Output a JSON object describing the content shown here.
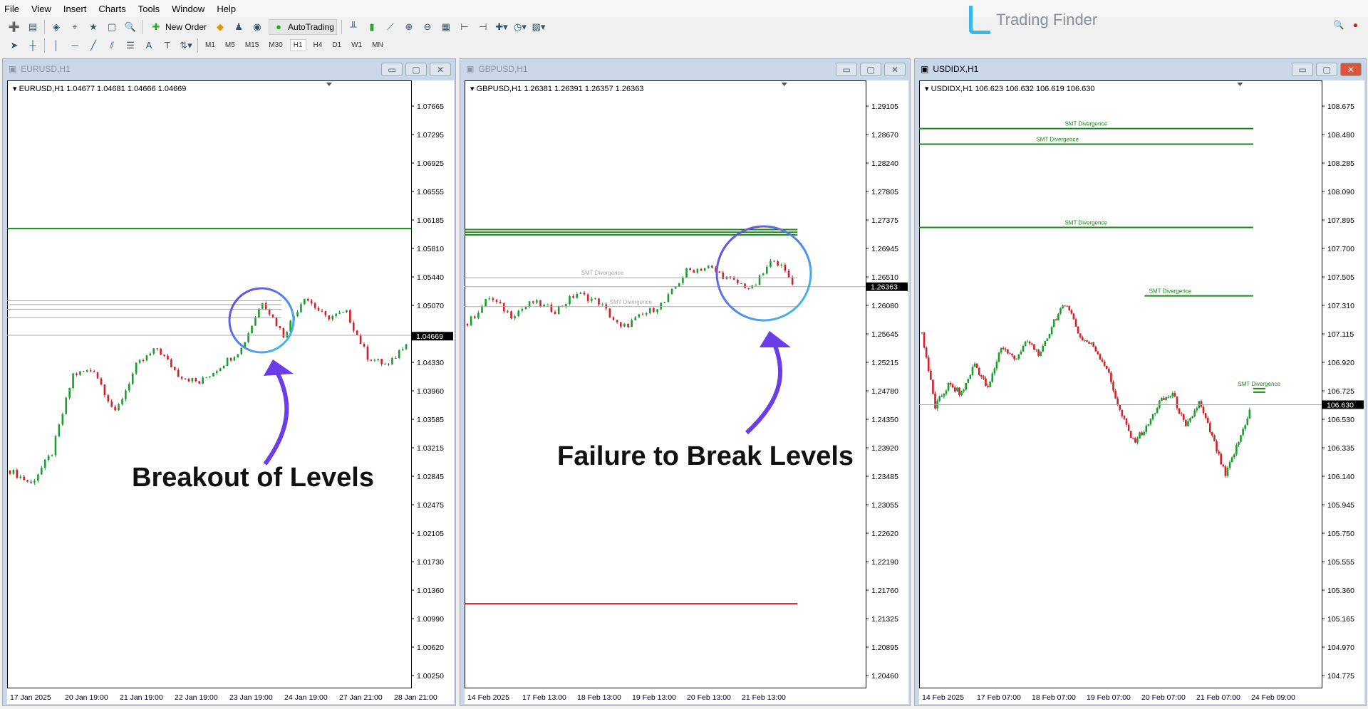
{
  "menu": [
    "File",
    "View",
    "Insert",
    "Charts",
    "Tools",
    "Window",
    "Help"
  ],
  "toolbar": {
    "new_order": "New Order",
    "autotrading": "AutoTrading",
    "timeframes": [
      "M1",
      "M5",
      "M15",
      "M30",
      "H1",
      "H4",
      "D1",
      "W1",
      "MN"
    ],
    "active_timeframe": "H1"
  },
  "logo": {
    "text": "Trading Finder",
    "color": "#35b8e8"
  },
  "colors": {
    "bull": "#1a9e2e",
    "bear": "#d0202a",
    "level_green": "#1a8a1a",
    "level_red": "#d0202a",
    "grid_line": "#aaaaaa"
  },
  "windows": [
    {
      "title": "EURUSD,H1",
      "ohlc": "EURUSD,H1  1.04677 1.04681 1.04666 1.04669",
      "current_price": "1.04669",
      "yticks": [
        "1.07665",
        "1.07295",
        "1.06925",
        "1.06555",
        "1.06185",
        "1.05810",
        "1.05440",
        "1.05070",
        "1.04700",
        "1.04330",
        "1.03960",
        "1.03585",
        "1.03215",
        "1.02845",
        "1.02475",
        "1.02105",
        "1.01730",
        "1.01360",
        "1.00990",
        "1.00620",
        "1.00250"
      ],
      "xticks": [
        "17 Jan 2025",
        "20 Jan 19:00",
        "21 Jan 19:00",
        "22 Jan 19:00",
        "23 Jan 19:00",
        "24 Jan 19:00",
        "27 Jan 21:00",
        "28 Jan 21:00"
      ],
      "closes": [
        1.0292,
        1.0275,
        1.0315,
        1.0417,
        1.0423,
        1.0366,
        1.0428,
        1.0451,
        1.0417,
        1.0406,
        1.0428,
        1.0451,
        1.0513,
        1.0468,
        1.0519,
        1.0491,
        1.0497,
        1.044,
        1.0428,
        1.04669
      ],
      "levels": [
        {
          "price": 1.0607,
          "color": "green",
          "full": true
        },
        {
          "price": 1.0513,
          "color": "grey"
        },
        {
          "price": 1.0508,
          "color": "grey"
        },
        {
          "price": 1.0502,
          "color": "grey"
        },
        {
          "price": 1.0491,
          "color": "grey"
        },
        {
          "price": 1.0468,
          "color": "grey",
          "full": true
        }
      ],
      "annotation": "Breakout of Levels"
    },
    {
      "title": "GBPUSD,H1",
      "ohlc": "GBPUSD,H1  1.26381 1.26391 1.26357 1.26363",
      "current_price": "1.26363",
      "yticks": [
        "1.29105",
        "1.28670",
        "1.28240",
        "1.27805",
        "1.27375",
        "1.26945",
        "1.26510",
        "1.26080",
        "1.25645",
        "1.25215",
        "1.24780",
        "1.24350",
        "1.23920",
        "1.23485",
        "1.23055",
        "1.22620",
        "1.22190",
        "1.21760",
        "1.21325",
        "1.20895",
        "1.20460"
      ],
      "xticks": [
        "14 Feb 2025",
        "17 Feb 13:00",
        "18 Feb 13:00",
        "19 Feb 13:00",
        "20 Feb 13:00",
        "21 Feb 13:00"
      ],
      "closes": [
        1.258,
        1.262,
        1.2593,
        1.2613,
        1.26,
        1.2626,
        1.2613,
        1.2573,
        1.2593,
        1.2613,
        1.266,
        1.2666,
        1.2646,
        1.2633,
        1.268,
        1.26363
      ],
      "levels": [
        {
          "price": 1.2723,
          "color": "green"
        },
        {
          "price": 1.2719,
          "color": "green"
        },
        {
          "price": 1.2715,
          "color": "green"
        },
        {
          "price": 1.265,
          "color": "grey",
          "label": "SMT Divergence"
        },
        {
          "price": 1.2606,
          "color": "grey",
          "label": "SMT Divergence"
        },
        {
          "price": 1.2155,
          "color": "red"
        },
        {
          "price": 1.26363,
          "color": "grey",
          "full": true
        }
      ],
      "annotation": "Failure to Break Levels"
    },
    {
      "title": "USDIDX,H1",
      "ohlc": "USDIDX,H1  106.623 106.632 106.619 106.630",
      "current_price": "106.630",
      "yticks": [
        "108.675",
        "108.480",
        "108.285",
        "108.090",
        "107.895",
        "107.700",
        "107.505",
        "107.310",
        "107.115",
        "106.920",
        "106.725",
        "106.530",
        "106.335",
        "106.140",
        "105.945",
        "105.750",
        "105.555",
        "105.360",
        "105.165",
        "104.970",
        "104.775"
      ],
      "xticks": [
        "14 Feb 2025",
        "17 Feb 07:00",
        "18 Feb 07:00",
        "19 Feb 07:00",
        "20 Feb 07:00",
        "21 Feb 07:00",
        "24 Feb 09:00"
      ],
      "closes": [
        107.12,
        106.615,
        106.764,
        106.704,
        106.912,
        106.734,
        107.031,
        106.942,
        107.06,
        106.971,
        107.209,
        107.328,
        107.09,
        107.031,
        106.882,
        106.586,
        106.378,
        106.467,
        106.645,
        106.704,
        106.467,
        106.645,
        106.407,
        106.14,
        106.378,
        106.63
      ],
      "levels": [
        {
          "price": 108.521,
          "color": "green",
          "label": "SMT Divergence"
        },
        {
          "price": 108.414,
          "color": "green",
          "label": "SMT Divergence"
        },
        {
          "price": 107.844,
          "color": "green",
          "label": "SMT Divergence"
        },
        {
          "price": 107.375,
          "color": "green",
          "label": "SMT Divergence",
          "from": 0.56
        },
        {
          "price": 106.74,
          "color": "green",
          "label": "SMT Divergence",
          "from": 0.86
        },
        {
          "price": 106.716,
          "color": "green",
          "from": 0.86
        },
        {
          "price": 106.63,
          "color": "grey",
          "full": true
        }
      ],
      "annotation": ""
    }
  ]
}
